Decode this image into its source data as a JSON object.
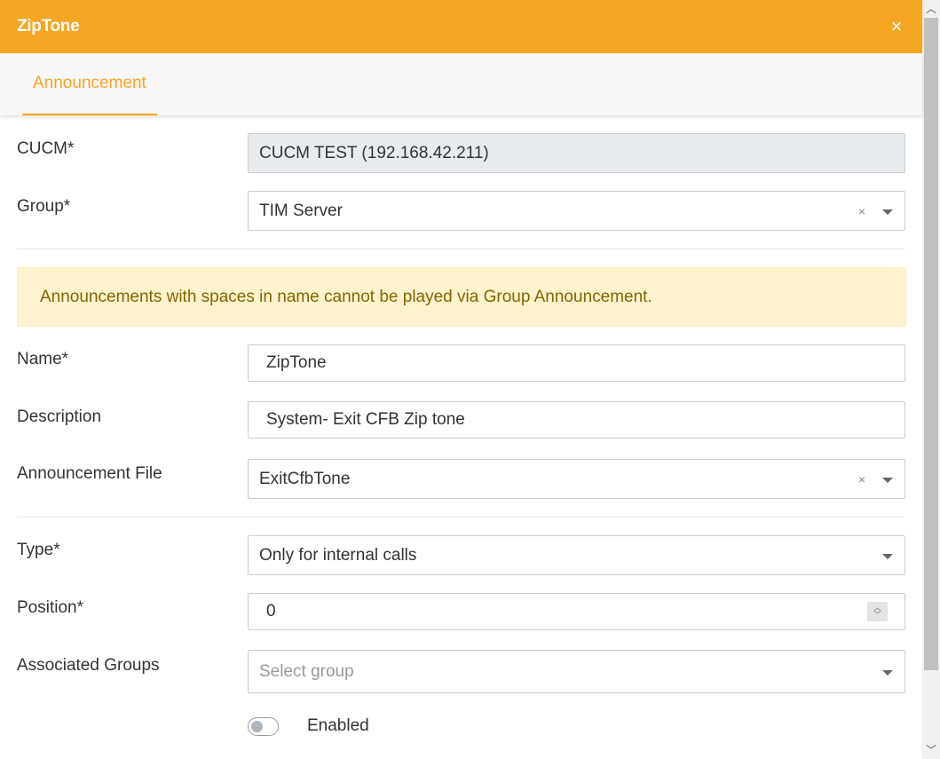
{
  "header": {
    "title": "ZipTone",
    "close_label": "×"
  },
  "tabs": [
    {
      "label": "Announcement",
      "active": true
    }
  ],
  "fields": {
    "cucm": {
      "label": "CUCM*",
      "value": "CUCM TEST (192.168.42.211)"
    },
    "group": {
      "label": "Group*",
      "value": "TIM Server",
      "clear": "×"
    },
    "name": {
      "label": "Name*",
      "value": "ZipTone"
    },
    "description": {
      "label": "Description",
      "value": "System- Exit CFB Zip tone"
    },
    "announcement_file": {
      "label": "Announcement File",
      "value": "ExitCfbTone",
      "clear": "×"
    },
    "type": {
      "label": "Type*",
      "value": "Only for internal calls"
    },
    "position": {
      "label": "Position*",
      "value": "0"
    },
    "associated_groups": {
      "label": "Associated Groups",
      "placeholder": "Select group"
    }
  },
  "alert": {
    "text": "Announcements with spaces in name cannot be played via Group Announcement."
  },
  "enabled": {
    "label": "Enabled",
    "checked": false
  },
  "colors": {
    "accent": "#f5a623",
    "alert_bg": "#fff3cd",
    "alert_text": "#856404"
  }
}
